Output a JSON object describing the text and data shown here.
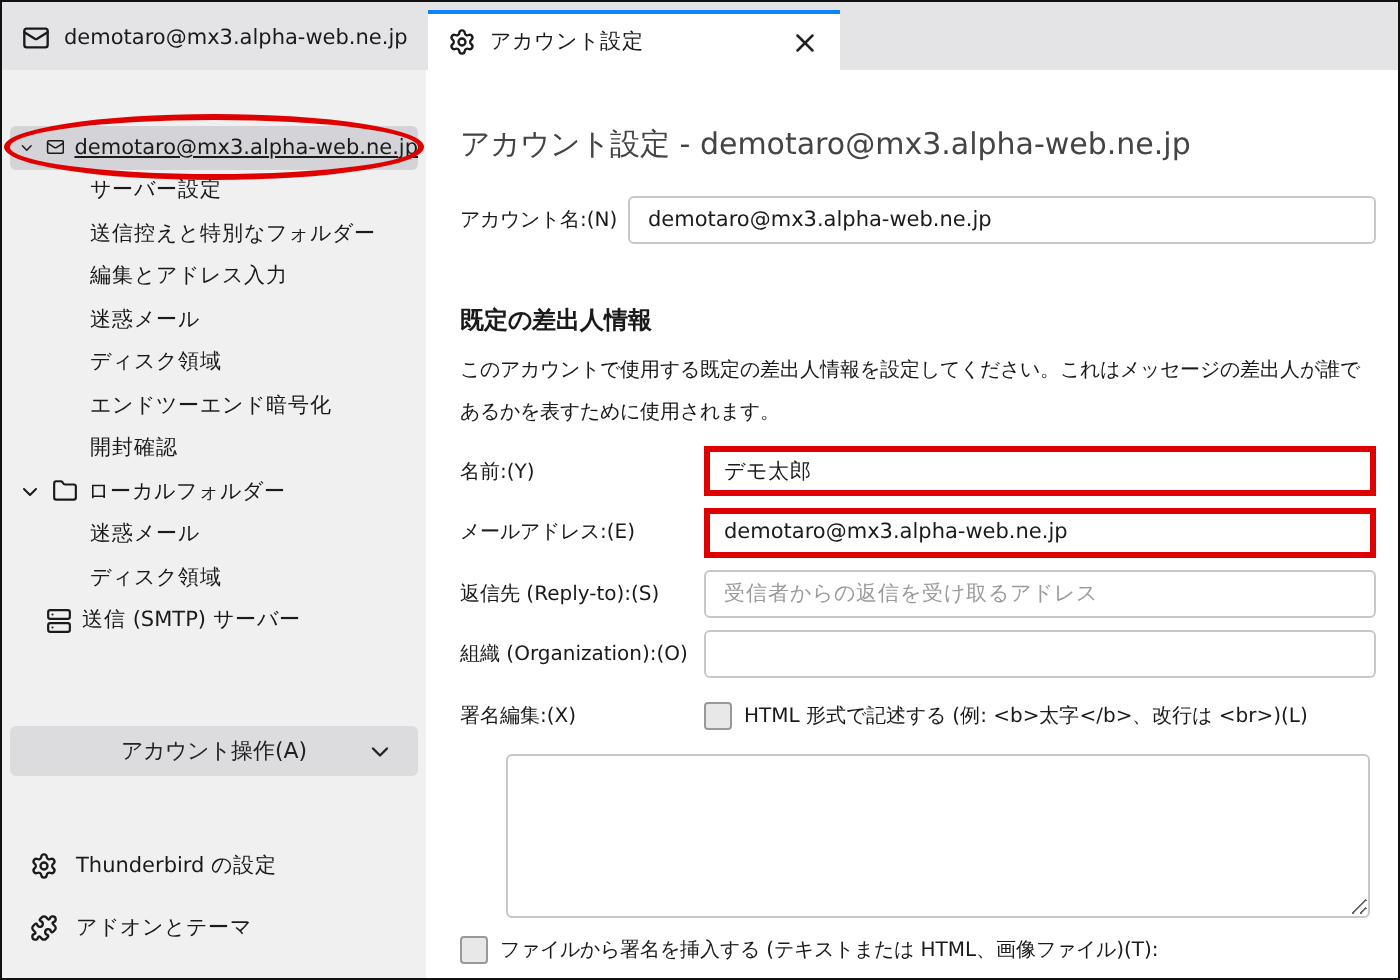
{
  "tabs": [
    {
      "label": "demotaro@mx3.alpha-web.ne.jp",
      "kind": "mail",
      "selected": false,
      "closable": false
    },
    {
      "label": "アカウント設定",
      "kind": "settings",
      "selected": true,
      "closable": true
    }
  ],
  "sidebar": {
    "tree": [
      {
        "label": "demotaro@mx3.alpha-web.ne.jp",
        "kind": "account",
        "expanded": true,
        "selected": true,
        "highlighted": true,
        "children": [
          {
            "label": "サーバー設定"
          },
          {
            "label": "送信控えと特別なフォルダー"
          },
          {
            "label": "編集とアドレス入力"
          },
          {
            "label": "迷惑メール"
          },
          {
            "label": "ディスク領域"
          },
          {
            "label": "エンドツーエンド暗号化"
          },
          {
            "label": "開封確認"
          }
        ]
      },
      {
        "label": "ローカルフォルダー",
        "kind": "folder",
        "expanded": true,
        "selected": false,
        "highlighted": false,
        "children": [
          {
            "label": "迷惑メール"
          },
          {
            "label": "ディスク領域"
          }
        ]
      },
      {
        "label": "送信 (SMTP) サーバー",
        "kind": "smtp",
        "selected": false,
        "highlighted": false
      }
    ],
    "action_button": "アカウント操作(A)",
    "footer": [
      {
        "label": "Thunderbird の設定",
        "kind": "gear"
      },
      {
        "label": "アドオンとテーマ",
        "kind": "puzzle"
      }
    ]
  },
  "main": {
    "title": "アカウント設定 - demotaro@mx3.alpha-web.ne.jp",
    "account_name": {
      "label": "アカウント名:(N)",
      "value": "demotaro@mx3.alpha-web.ne.jp"
    },
    "identity": {
      "heading": "既定の差出人情報",
      "description": "このアカウントで使用する既定の差出人情報を設定してください。これはメッセージの差出人が誰であるかを表すために使用されます。",
      "fields": [
        {
          "label": "名前:(Y)",
          "value": "デモ太郎",
          "highlighted": true
        },
        {
          "label": "メールアドレス:(E)",
          "value": "demotaro@mx3.alpha-web.ne.jp",
          "highlighted": true
        },
        {
          "label": "返信先 (Reply-to):(S)",
          "placeholder": "受信者からの返信を受け取るアドレス",
          "highlighted": false
        },
        {
          "label": "組織 (Organization):(O)",
          "highlighted": false
        }
      ],
      "signature": {
        "label": "署名編集:(X)",
        "html_checkbox": {
          "label": "HTML 形式で記述する (例: <b>太字</b>、改行は <br>)(L)",
          "checked": false
        }
      },
      "file_checkbox": {
        "label": "ファイルから署名を挿入する (テキストまたは HTML、画像ファイル)(T):",
        "checked": false
      }
    }
  }
}
